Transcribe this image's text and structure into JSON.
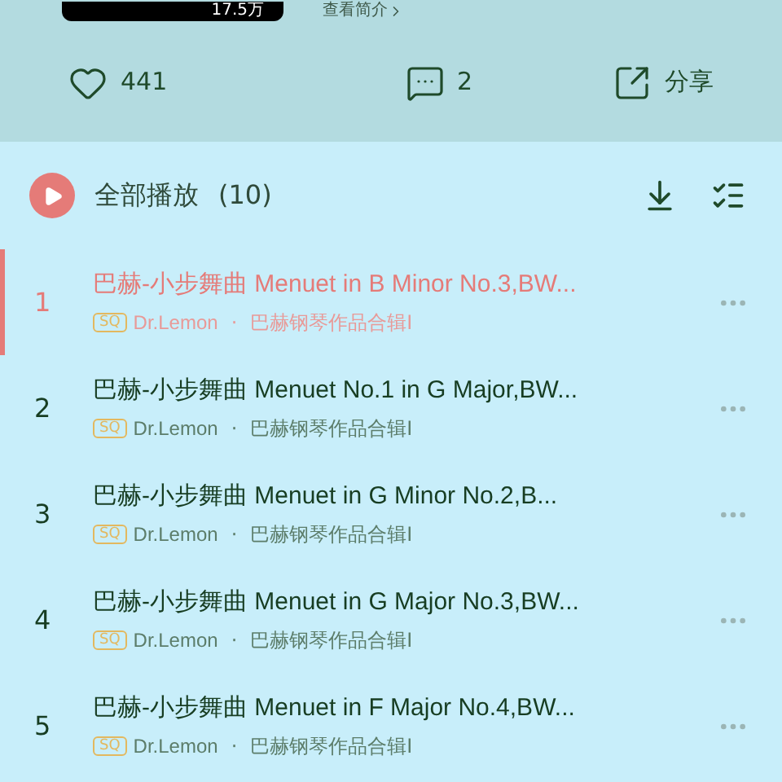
{
  "header": {
    "play_count": "17.5万",
    "intro_link": "查看简介"
  },
  "actions": {
    "likes": "441",
    "comments": "2",
    "share": "分享"
  },
  "play_all": {
    "label": "全部播放",
    "count": "(10)"
  },
  "songs": [
    {
      "index": "1",
      "title": "巴赫-小步舞曲 Menuet in B Minor No.3,BW...",
      "quality": "SQ",
      "artist": "Dr.Lemon",
      "separator": "·",
      "album": "巴赫钢琴作品合辑I",
      "selected": true
    },
    {
      "index": "2",
      "title": "巴赫-小步舞曲 Menuet No.1 in G Major,BW...",
      "quality": "SQ",
      "artist": "Dr.Lemon",
      "separator": "·",
      "album": "巴赫钢琴作品合辑I",
      "selected": false
    },
    {
      "index": "3",
      "title": "巴赫-小步舞曲 Menuet in G Minor No.2,B...",
      "quality": "SQ",
      "artist": "Dr.Lemon",
      "separator": "·",
      "album": "巴赫钢琴作品合辑I",
      "selected": false
    },
    {
      "index": "4",
      "title": "巴赫-小步舞曲 Menuet in G Major No.3,BW...",
      "quality": "SQ",
      "artist": "Dr.Lemon",
      "separator": "·",
      "album": "巴赫钢琴作品合辑I",
      "selected": false
    },
    {
      "index": "5",
      "title": "巴赫-小步舞曲 Menuet in F Major No.4,BW...",
      "quality": "SQ",
      "artist": "Dr.Lemon",
      "separator": "·",
      "album": "巴赫钢琴作品合辑I",
      "selected": false
    }
  ]
}
